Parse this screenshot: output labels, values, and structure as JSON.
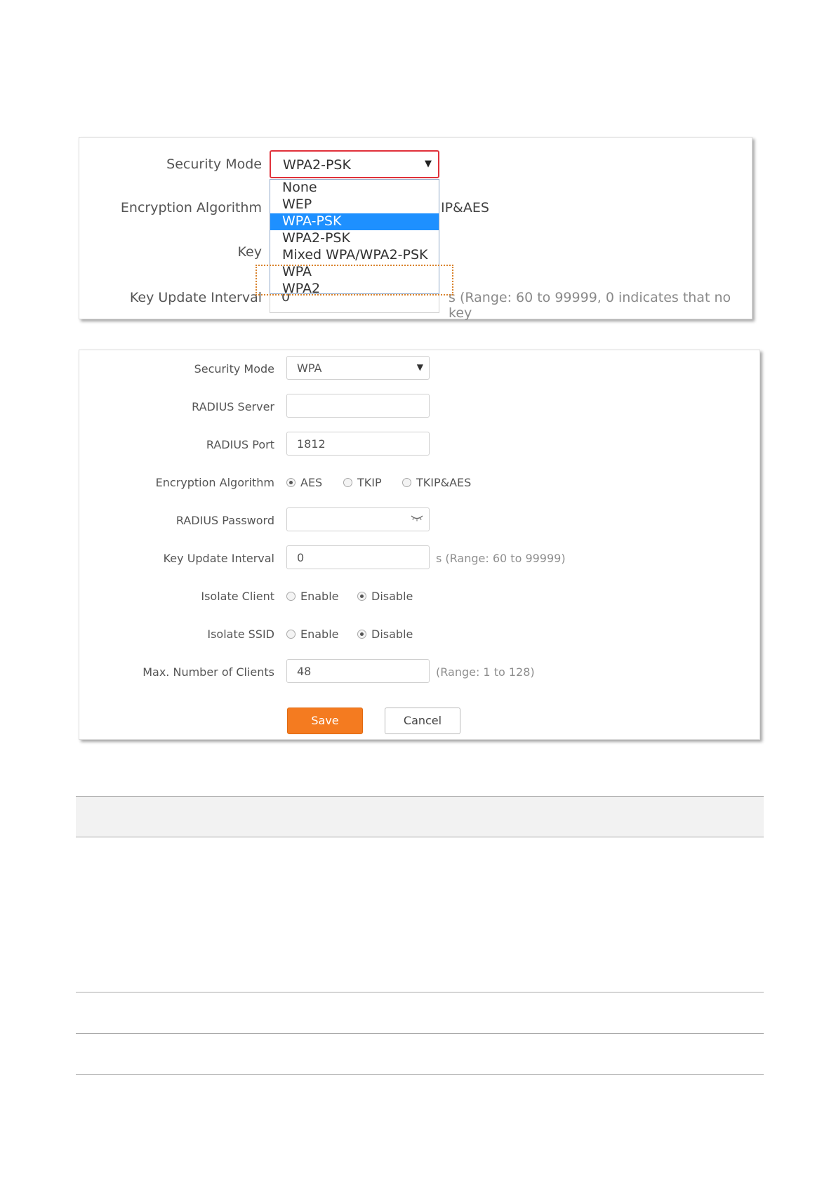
{
  "panel1": {
    "labels": {
      "security_mode": "Security Mode",
      "encryption_algorithm": "Encryption Algorithm",
      "key": "Key",
      "key_update_interval": "Key Update Interval"
    },
    "security_mode_value": "WPA2-PSK",
    "dropdown_options": [
      "None",
      "WEP",
      "WPA-PSK",
      "WPA2-PSK",
      "Mixed WPA/WPA2-PSK",
      "WPA",
      "WPA2"
    ],
    "highlighted_option": "WPA-PSK",
    "encryption_fragment": "IP&AES",
    "key_update_value_fragment": "0",
    "key_update_hint": "s (Range: 60 to 99999, 0 indicates that no key"
  },
  "panel2": {
    "security_mode": {
      "label": "Security Mode",
      "value": "WPA"
    },
    "radius_server": {
      "label": "RADIUS Server",
      "value": ""
    },
    "radius_port": {
      "label": "RADIUS Port",
      "value": "1812"
    },
    "encryption_algorithm": {
      "label": "Encryption Algorithm",
      "options": [
        "AES",
        "TKIP",
        "TKIP&AES"
      ],
      "selected": "AES"
    },
    "radius_password": {
      "label": "RADIUS Password",
      "value": ""
    },
    "key_update_interval": {
      "label": "Key Update Interval",
      "value": "0",
      "hint": "s (Range: 60 to 99999)"
    },
    "isolate_client": {
      "label": "Isolate Client",
      "options": [
        "Enable",
        "Disable"
      ],
      "selected": "Disable"
    },
    "isolate_ssid": {
      "label": "Isolate SSID",
      "options": [
        "Enable",
        "Disable"
      ],
      "selected": "Disable"
    },
    "max_clients": {
      "label": "Max. Number of Clients",
      "value": "48",
      "hint": "(Range: 1 to 128)"
    },
    "save_label": "Save",
    "cancel_label": "Cancel"
  },
  "colors": {
    "accent_orange": "#f47b20",
    "select_highlight": "#1e90ff",
    "active_border_red": "#e0313a",
    "callout_dotted": "#d9822b"
  }
}
